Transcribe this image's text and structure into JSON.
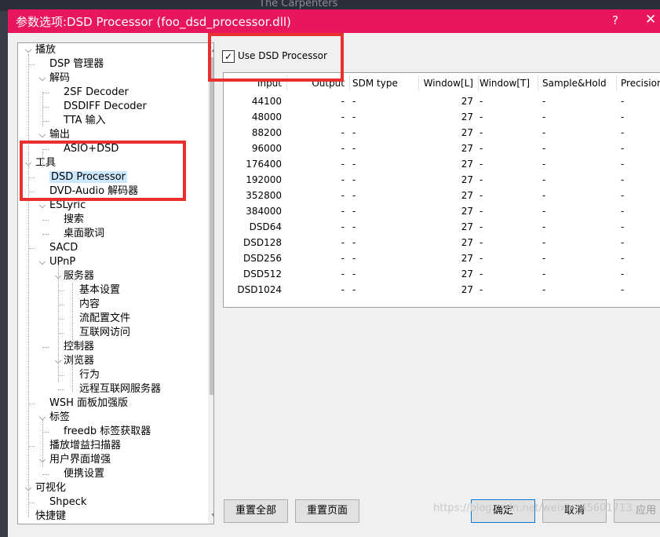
{
  "background": {
    "text": "The Carpenters"
  },
  "window": {
    "title": "参数选项:DSD Processor (foo_dsd_processor.dll)",
    "help": "?",
    "close": "✕",
    "accent": "#e8175d"
  },
  "tree": {
    "nodes": [
      {
        "label": "播放",
        "expander": "⌵"
      },
      {
        "label": "DSP 管理器"
      },
      {
        "label": "解码",
        "expander": "⌵"
      },
      {
        "label": "2SF Decoder"
      },
      {
        "label": "DSDIFF Decoder"
      },
      {
        "label": "TTA 输入"
      },
      {
        "label": "输出",
        "expander": "⌵"
      },
      {
        "label": "ASIO+DSD"
      },
      {
        "label": "工具",
        "expander": "⌵"
      },
      {
        "label": "DSD Processor",
        "selected": true
      },
      {
        "label": "DVD-Audio 解码器"
      },
      {
        "label": "ESLyric",
        "expander": "⌵"
      },
      {
        "label": "搜索"
      },
      {
        "label": "桌面歌词"
      },
      {
        "label": "SACD"
      },
      {
        "label": "UPnP",
        "expander": "⌵"
      },
      {
        "label": "服务器",
        "expander": "⌵"
      },
      {
        "label": "基本设置"
      },
      {
        "label": "内容"
      },
      {
        "label": "流配置文件"
      },
      {
        "label": "互联网访问"
      },
      {
        "label": "控制器"
      },
      {
        "label": "浏览器",
        "expander": "⌵"
      },
      {
        "label": "行为"
      },
      {
        "label": "远程互联网服务器"
      },
      {
        "label": "WSH 面板加强版"
      },
      {
        "label": "标签",
        "expander": "⌵"
      },
      {
        "label": "freedb 标签获取器"
      },
      {
        "label": "播放增益扫描器"
      },
      {
        "label": "用户界面增强",
        "expander": "⌵"
      },
      {
        "label": "便携设置"
      },
      {
        "label": "可视化",
        "expander": "⌵"
      },
      {
        "label": "Shpeck"
      },
      {
        "label": "快捷键"
      }
    ]
  },
  "scroll": {
    "up": "▲",
    "down": "▼"
  },
  "use_dsd": {
    "label": "Use DSD Processor",
    "checked": true,
    "mark": "✓"
  },
  "table": {
    "headers": [
      "Input",
      "Output",
      "SDM type",
      "Window[L]",
      "Window[T]",
      "Sample&Hold",
      "Precision"
    ],
    "rows": [
      [
        "44100",
        "-",
        "-",
        "27",
        "-",
        "-",
        "-"
      ],
      [
        "48000",
        "-",
        "-",
        "27",
        "-",
        "-",
        "-"
      ],
      [
        "88200",
        "-",
        "-",
        "27",
        "-",
        "-",
        "-"
      ],
      [
        "96000",
        "-",
        "-",
        "27",
        "-",
        "-",
        "-"
      ],
      [
        "176400",
        "-",
        "-",
        "27",
        "-",
        "-",
        "-"
      ],
      [
        "192000",
        "-",
        "-",
        "27",
        "-",
        "-",
        "-"
      ],
      [
        "352800",
        "-",
        "-",
        "27",
        "-",
        "-",
        "-"
      ],
      [
        "384000",
        "-",
        "-",
        "27",
        "-",
        "-",
        "-"
      ],
      [
        "DSD64",
        "-",
        "-",
        "27",
        "-",
        "-",
        "-"
      ],
      [
        "DSD128",
        "-",
        "-",
        "27",
        "-",
        "-",
        "-"
      ],
      [
        "DSD256",
        "-",
        "-",
        "27",
        "-",
        "-",
        "-"
      ],
      [
        "DSD512",
        "-",
        "-",
        "27",
        "-",
        "-",
        "-"
      ],
      [
        "DSD1024",
        "-",
        "-",
        "27",
        "-",
        "-",
        "-"
      ]
    ]
  },
  "buttons": {
    "reset_all": "重置全部",
    "reset_page": "重置页面",
    "ok": "确定",
    "cancel": "取消",
    "apply": "应用"
  },
  "watermark": "https://blog.csdn.net/weixin_45601713"
}
